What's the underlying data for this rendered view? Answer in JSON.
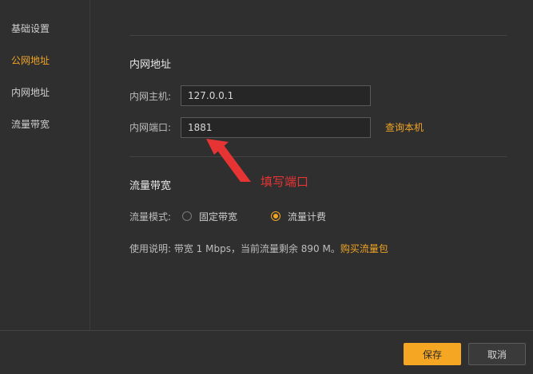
{
  "sidebar": {
    "items": [
      {
        "label": "基础设置"
      },
      {
        "label": "公网地址"
      },
      {
        "label": "内网地址"
      },
      {
        "label": "流量带宽"
      }
    ],
    "active_index": 1
  },
  "intranet": {
    "title": "内网地址",
    "host_label": "内网主机:",
    "host_value": "127.0.0.1",
    "port_label": "内网端口:",
    "port_value": "1881",
    "query_link": "查询本机"
  },
  "bandwidth": {
    "title": "流量带宽",
    "mode_label": "流量模式:",
    "options": [
      {
        "label": "固定带宽",
        "checked": false
      },
      {
        "label": "流量计费",
        "checked": true
      }
    ],
    "usage_text": "使用说明:  带宽 1 Mbps，当前流量剩余 890 M。",
    "buy_link": "购买流量包"
  },
  "annotation": {
    "text": "填写端口",
    "color": "#e63434"
  },
  "footer": {
    "save_label": "保存",
    "cancel_label": "取消"
  },
  "colors": {
    "accent": "#f0a424",
    "background": "#2f2f2f"
  }
}
